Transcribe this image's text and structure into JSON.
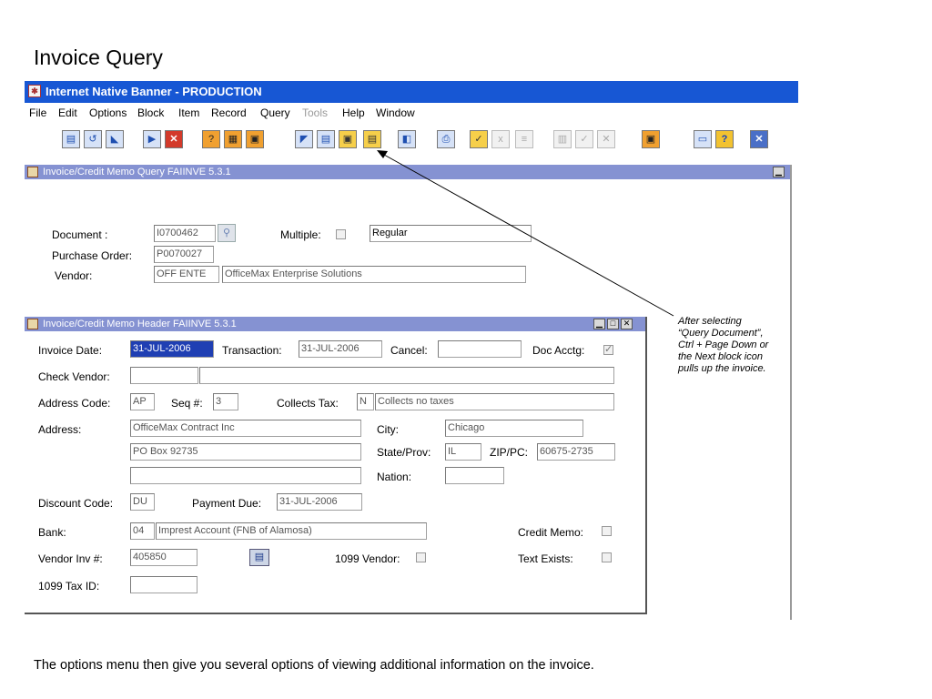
{
  "slide": {
    "title": "Invoice Query",
    "caption": "The options menu then give you several options of viewing additional information on the invoice.",
    "annotation": "After selecting “Query Document”, Ctrl + Page Down or the Next block icon pulls up the invoice."
  },
  "app": {
    "title": "Internet Native Banner - PRODUCTION",
    "menu": [
      "File",
      "Edit",
      "Options",
      "Block",
      "Item",
      "Record",
      "Query",
      "Tools",
      "Help",
      "Window"
    ],
    "menu_disabled": [
      "Tools"
    ]
  },
  "query_window": {
    "title": "Invoice/Credit Memo Query  FAIINVE  5.3.1",
    "document_label": "Document :",
    "document_value": "I0700462",
    "multiple_label": "Multiple:",
    "multiple_value": "Regular",
    "po_label": "Purchase Order:",
    "po_value": "P0070027",
    "vendor_label": "Vendor:",
    "vendor_id": "OFF  ENTE",
    "vendor_name": "OfficeMax Enterprise Solutions"
  },
  "header_window": {
    "title": "Invoice/Credit Memo Header  FAIINVE  5.3.1",
    "invoice_date_label": "Invoice Date:",
    "invoice_date": "31-JUL-2006",
    "transaction_label": "Transaction:",
    "transaction": "31-JUL-2006",
    "cancel_label": "Cancel:",
    "cancel": "",
    "doc_acctg_label": "Doc  Acctg:",
    "check_vendor_label": "Check Vendor:",
    "check_vendor": "",
    "check_vendor_name": "",
    "address_code_label": "Address Code:",
    "address_code": "AP",
    "seq_label": "Seq #:",
    "seq": "3",
    "collects_tax_label": "Collects Tax:",
    "collects_tax": "N",
    "collects_tax_desc": "Collects no taxes",
    "address_label": "Address:",
    "address_line1": "OfficeMax Contract Inc",
    "address_line2": "PO Box 92735",
    "address_line3": "",
    "city_label": "City:",
    "city": "Chicago",
    "state_label": "State/Prov:",
    "state": "IL",
    "zip_label": "ZIP/PC:",
    "zip": "60675-2735",
    "nation_label": "Nation:",
    "nation": "",
    "discount_code_label": "Discount Code:",
    "discount_code": "DU",
    "payment_due_label": "Payment Due:",
    "payment_due": "31-JUL-2006",
    "bank_label": "Bank:",
    "bank_code": "04",
    "bank_name": "Imprest Account (FNB of Alamosa)",
    "credit_memo_label": "Credit Memo:",
    "vendor_inv_label": "Vendor Inv #:",
    "vendor_inv": "405850",
    "vendor_1099_label": "1099 Vendor:",
    "text_exists_label": "Text Exists:",
    "tax_id_label": "1099 Tax ID:",
    "tax_id": ""
  }
}
